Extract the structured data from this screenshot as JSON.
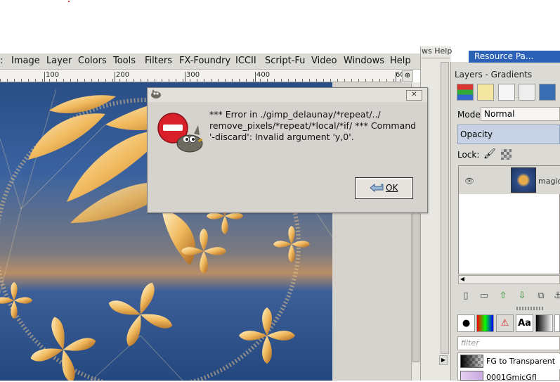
{
  "image_window": {
    "menu": [
      "Image",
      "Layer",
      "Colors",
      "Tools",
      "Filters",
      "FX-Foundry",
      "ICCII",
      "Script-Fu",
      "Video",
      "Windows",
      "Help"
    ],
    "ruler_ticks": [
      "100",
      "200",
      "300",
      "400",
      "60"
    ],
    "corner_button_glyph": "⊕"
  },
  "back_window": {
    "title_fragment": "ws  Help"
  },
  "dock": {
    "resource_tab": "Resource Pa...",
    "title": "Layers - Gradients",
    "mode_label": "Mode:",
    "mode_value": "Normal",
    "opacity_label": "Opacity",
    "lock_label": "Lock:",
    "layer_name": "magicb",
    "filter_placeholder": "filter",
    "gradients": [
      "FG to Transparent",
      "0001GmicGfl"
    ]
  },
  "dialog": {
    "message": "*** Error in ./gimp_delaunay/*repeat/../ remove_pixels/*repeat/*local/*if/ *** Command '-discard': Invalid argument 'y,0'.",
    "ok_label": "OK",
    "close_glyph": "✕"
  },
  "colors": {
    "menubar": "#dcdad5",
    "resource_tab": "#2b62b8",
    "error_red": "#d8202a"
  }
}
